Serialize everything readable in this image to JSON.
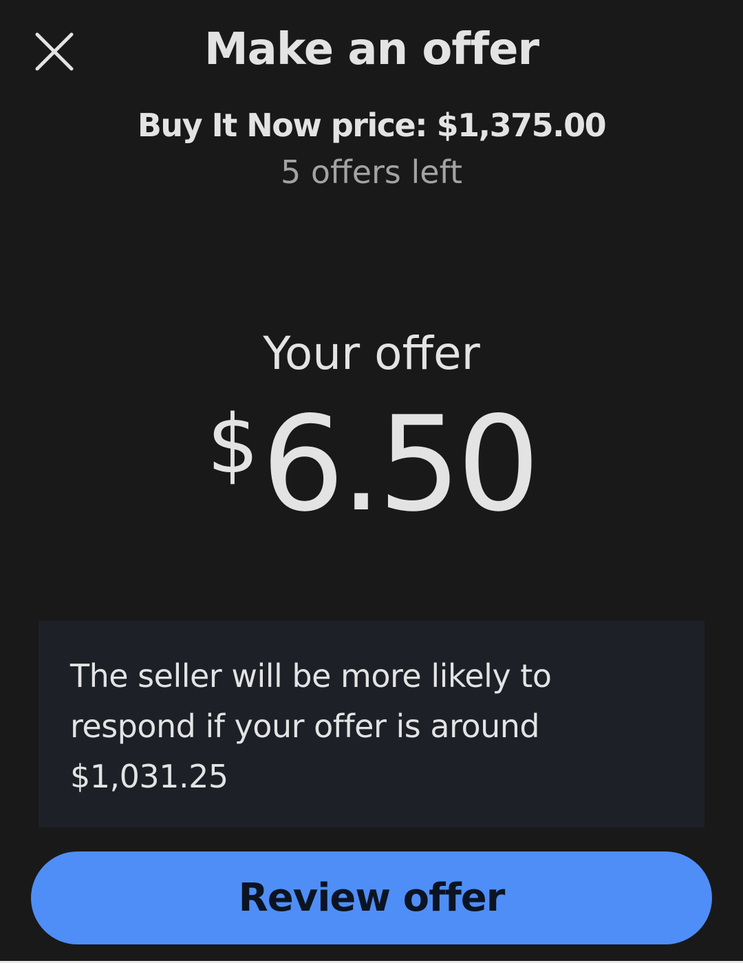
{
  "header": {
    "close_icon": "close-icon",
    "title": "Make an offer"
  },
  "listing": {
    "buy_it_now": "Buy It Now price: $1,375.00",
    "offers_left": "5 offers left"
  },
  "offer": {
    "label": "Your offer",
    "currency_symbol": "$",
    "amount": "6.50"
  },
  "hint": {
    "text": "The seller will be more likely to respond if your offer is around $1,031.25"
  },
  "actions": {
    "review_label": "Review offer"
  },
  "colors": {
    "background": "#191919",
    "hint_background": "#1d2127",
    "primary_button": "#4f8ef7",
    "text": "#e3e3e3",
    "muted_text": "#a3a3a3"
  }
}
